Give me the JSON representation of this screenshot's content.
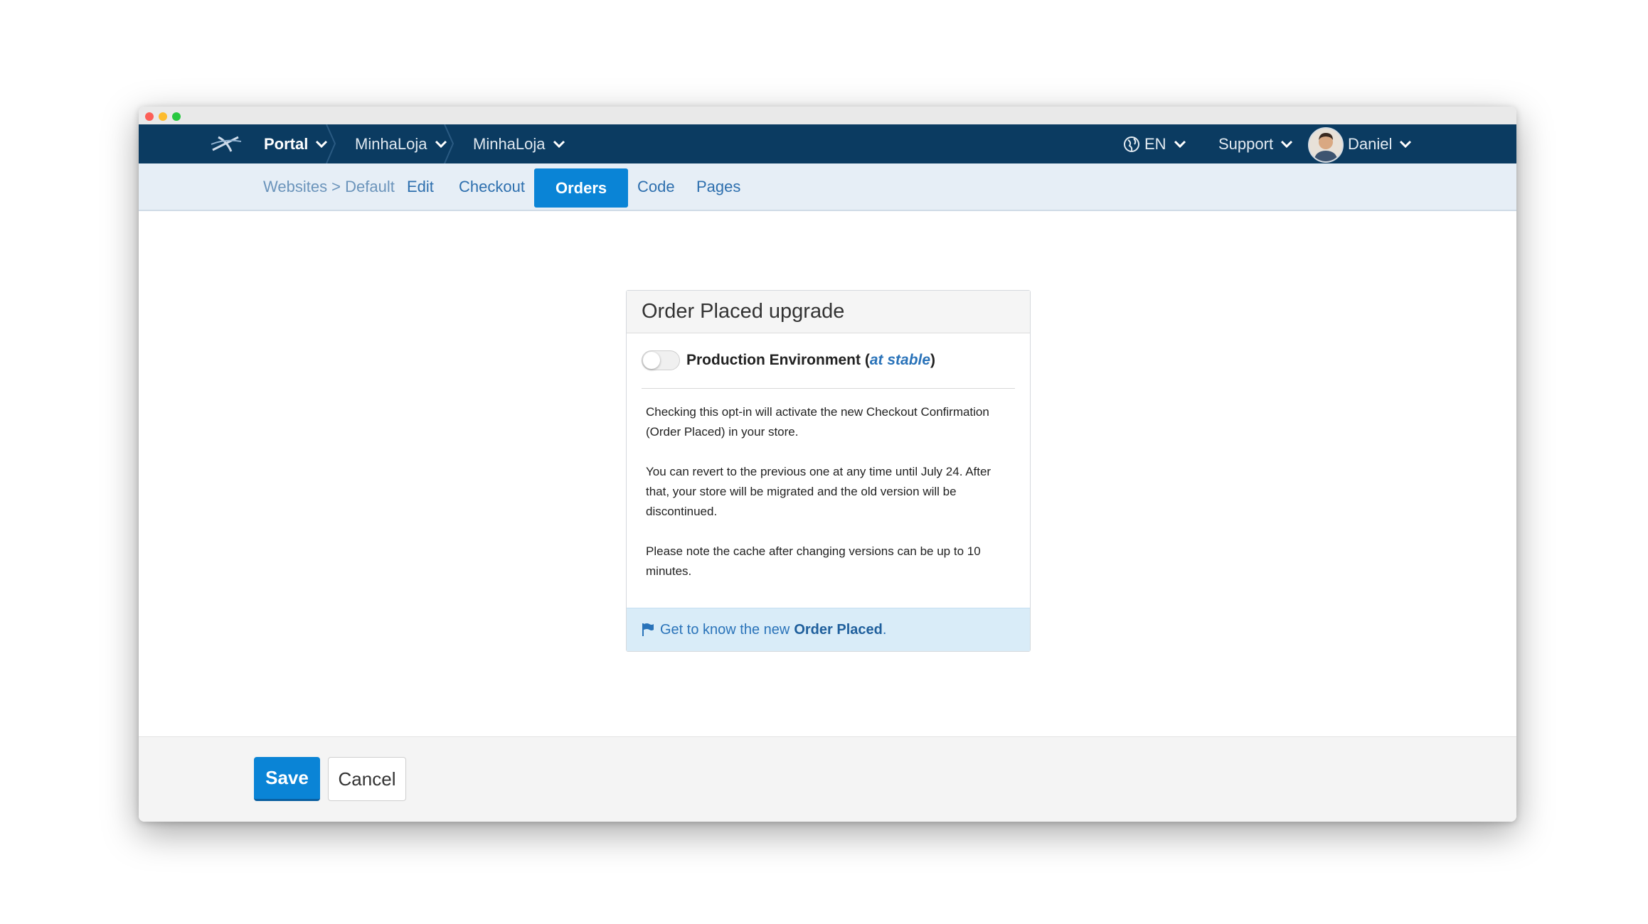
{
  "topnav": {
    "breadcrumbs": [
      {
        "label": "Portal"
      },
      {
        "label": "MinhaLoja"
      },
      {
        "label": "MinhaLoja"
      }
    ],
    "language": "EN",
    "support": "Support",
    "user": "Daniel"
  },
  "subnav": {
    "path": "Websites > Default",
    "tabs": [
      {
        "label": "Edit"
      },
      {
        "label": "Checkout"
      },
      {
        "label": "Orders"
      },
      {
        "label": "Code"
      },
      {
        "label": "Pages"
      }
    ],
    "active_tab": "Orders"
  },
  "panel": {
    "title": "Order Placed upgrade",
    "toggle": {
      "label": "Production Environment",
      "state_text": "at stable",
      "enabled": false
    },
    "paragraphs": [
      "Checking this opt-in will activate the new Checkout Confirmation (Order Placed) in your store.",
      "You can revert to the previous one at any time until July 24. After that, your store will be migrated and the old version will be discontinued.",
      "Please note the cache after changing versions can be up to 10 minutes."
    ],
    "footer": {
      "text": "Get to know the new",
      "link": "Order Placed",
      "suffix": "."
    }
  },
  "actions": {
    "save": "Save",
    "cancel": "Cancel"
  },
  "colors": {
    "nav_bg": "#0b3b61",
    "subnav_bg": "#e6eef6",
    "accent": "#0a84d6",
    "link": "#2a73b9"
  }
}
